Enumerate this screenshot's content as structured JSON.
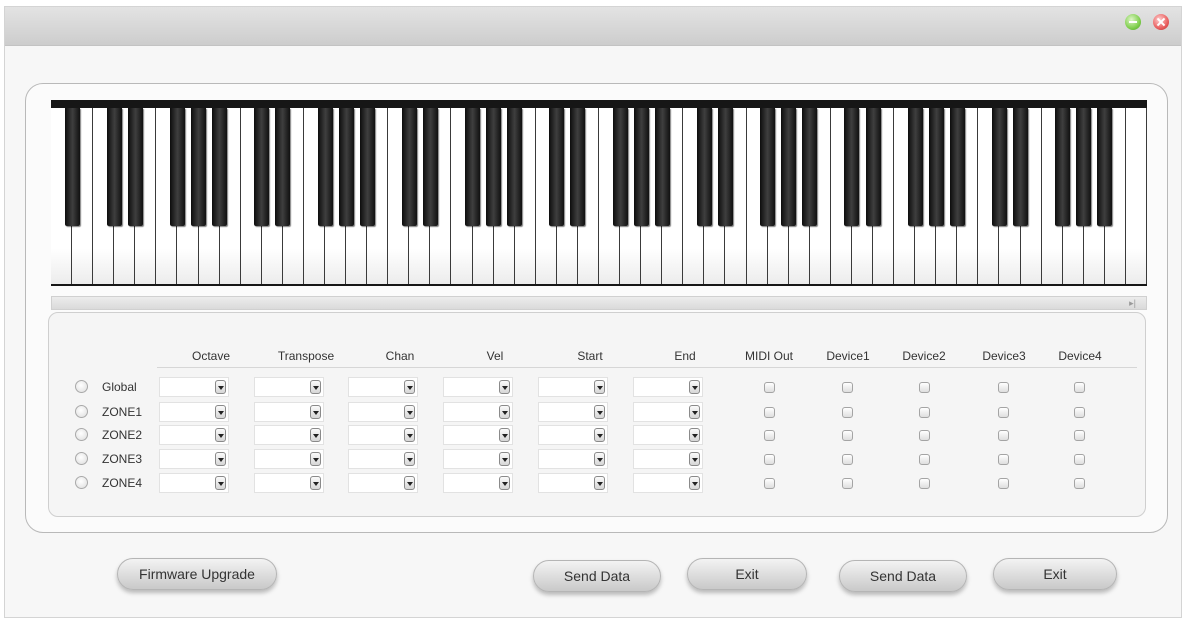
{
  "columns": {
    "octave": "Octave",
    "transpose": "Transpose",
    "chan": "Chan",
    "vel": "Vel",
    "start": "Start",
    "end": "End",
    "midi_out": "MIDI Out",
    "device1": "Device1",
    "device2": "Device2",
    "device3": "Device3",
    "device4": "Device4"
  },
  "rows": [
    {
      "label": "Global"
    },
    {
      "label": "ZONE1"
    },
    {
      "label": "ZONE2"
    },
    {
      "label": "ZONE3"
    },
    {
      "label": "ZONE4"
    }
  ],
  "buttons": {
    "firmware": "Firmware Upgrade",
    "send_data_1": "Send Data",
    "exit_1": "Exit",
    "send_data_2": "Send Data",
    "exit_2": "Exit"
  },
  "icons": {
    "minimize": "minimize-icon",
    "close": "close-icon"
  },
  "colors": {
    "minimize": "#7fcf4d",
    "close": "#e96060"
  }
}
